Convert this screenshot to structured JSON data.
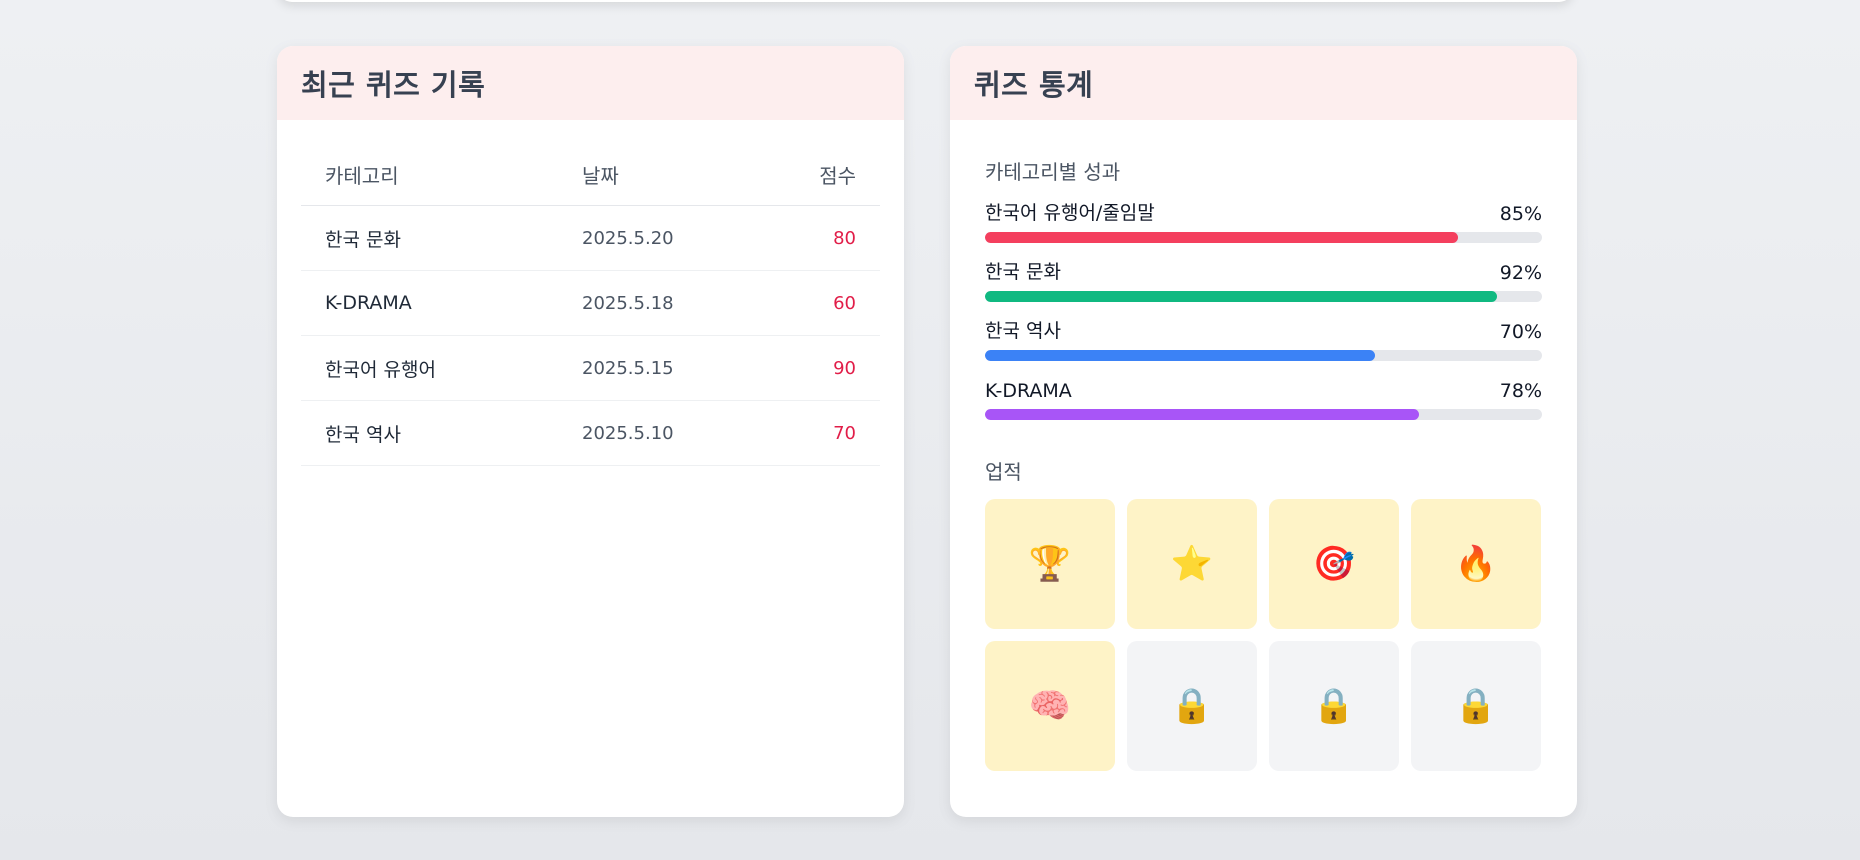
{
  "history": {
    "title": "최근 퀴즈 기록",
    "columns": {
      "category": "카테고리",
      "date": "날짜",
      "score": "점수"
    },
    "rows": [
      {
        "category": "한국 문화",
        "date": "2025.5.20",
        "score": "80"
      },
      {
        "category": "K-DRAMA",
        "date": "2025.5.18",
        "score": "60"
      },
      {
        "category": "한국어 유행어",
        "date": "2025.5.15",
        "score": "90"
      },
      {
        "category": "한국 역사",
        "date": "2025.5.10",
        "score": "70"
      }
    ]
  },
  "stats": {
    "title": "퀴즈 통계",
    "performance_label": "카테고리별 성과",
    "categories": [
      {
        "name": "한국어 유행어/줄임말",
        "percent_label": "85%",
        "value": 85,
        "color": "#f43f5e"
      },
      {
        "name": "한국 문화",
        "percent_label": "92%",
        "value": 92,
        "color": "#10b981"
      },
      {
        "name": "한국 역사",
        "percent_label": "70%",
        "value": 70,
        "color": "#3b82f6"
      },
      {
        "name": "K-DRAMA",
        "percent_label": "78%",
        "value": 78,
        "color": "#a855f7"
      }
    ],
    "achievements_label": "업적",
    "achievements": [
      {
        "icon": "trophy-icon",
        "glyph": "🏆",
        "unlocked": true
      },
      {
        "icon": "star-icon",
        "glyph": "⭐",
        "unlocked": true
      },
      {
        "icon": "target-icon",
        "glyph": "🎯",
        "unlocked": true
      },
      {
        "icon": "fire-icon",
        "glyph": "🔥",
        "unlocked": true
      },
      {
        "icon": "brain-icon",
        "glyph": "🧠",
        "unlocked": true
      },
      {
        "icon": "lock-icon",
        "glyph": "🔒",
        "unlocked": false
      },
      {
        "icon": "lock-icon",
        "glyph": "🔒",
        "unlocked": false
      },
      {
        "icon": "lock-icon",
        "glyph": "🔒",
        "unlocked": false
      }
    ]
  }
}
